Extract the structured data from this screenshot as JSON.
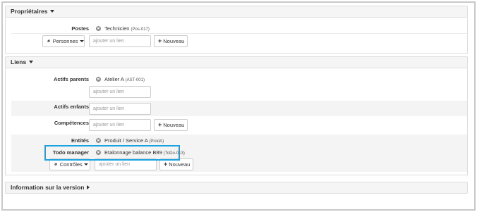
{
  "proprietaires": {
    "title": "Propriétaires",
    "postes_label": "Postes",
    "postes_value": "Technicien",
    "postes_code": "(Pos-017)",
    "personnes_button": "Personnes",
    "add_link_placeholder": "ajouter un lien",
    "nouveau_label": "Nouveau"
  },
  "liens": {
    "title": "Liens",
    "actifs_parents_label": "Actifs parents",
    "actifs_parents_value": "Atelier A",
    "actifs_parents_code": "(AST-001)",
    "actifs_enfants_label": "Actifs enfants",
    "competences_label": "Compétences",
    "entites_label": "Entités",
    "entites_value": "Produit / Service A",
    "entites_code": "(ProdA)",
    "todo_manager_label": "Todo manager",
    "todo_manager_value": "Etalonnage balance B89",
    "todo_manager_code": "(ToDo-013)",
    "controles_button": "Contrôles",
    "add_link_placeholder": "ajouter un lien",
    "nouveau_label": "Nouveau"
  },
  "version": {
    "title": "Information sur la version"
  },
  "colors": {
    "highlight": "#1aa3e3",
    "panel_header_bg": "#f5f5f5"
  }
}
